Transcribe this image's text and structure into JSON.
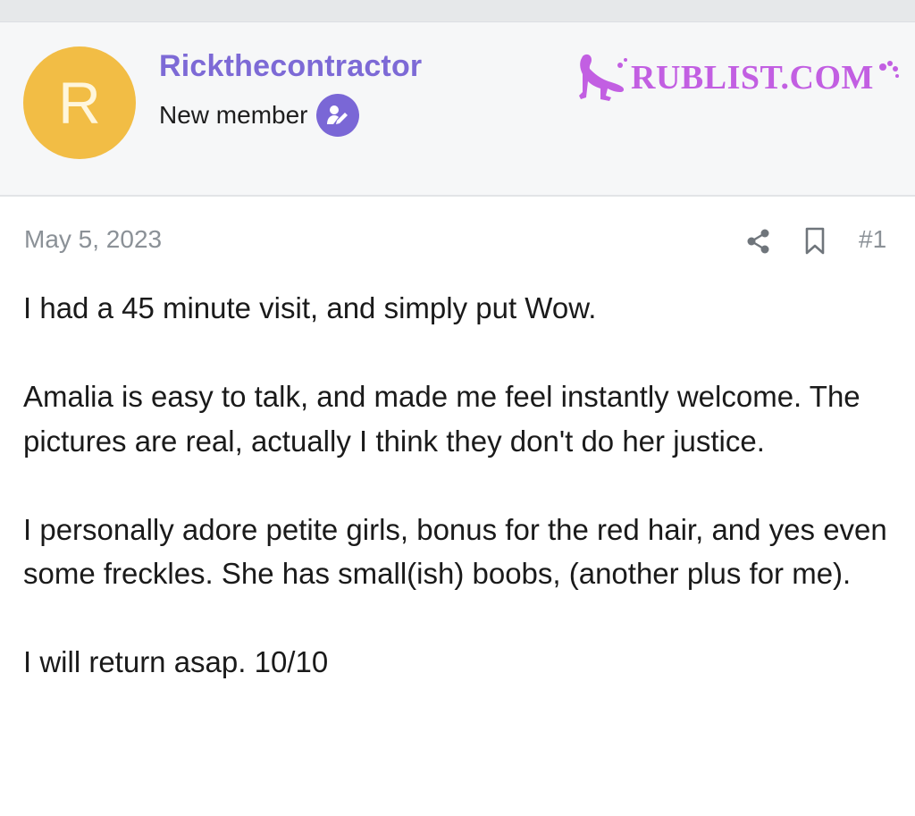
{
  "user": {
    "avatar_letter": "R",
    "name": "Rickthecontractor",
    "role": "New member",
    "role_icon": "user-pen-icon",
    "avatar_color": "#f2bd45",
    "name_color": "#7d6ad6"
  },
  "watermark": {
    "text": "RUBLIST.COM",
    "color": "#c25fe2"
  },
  "post": {
    "date": "May 5, 2023",
    "share_icon": "share-icon",
    "bookmark_icon": "bookmark-icon",
    "number": "#1",
    "paragraphs": [
      "I had a 45 minute visit, and simply put Wow.",
      "Amalia is easy to talk, and made me feel instantly welcome. The pictures are real, actually I think they don't do her justice.",
      "I personally adore petite girls, bonus for the red hair, and yes even some freckles. She has small(ish) boobs, (another plus for me).",
      "I will return asap. 10/10"
    ]
  }
}
